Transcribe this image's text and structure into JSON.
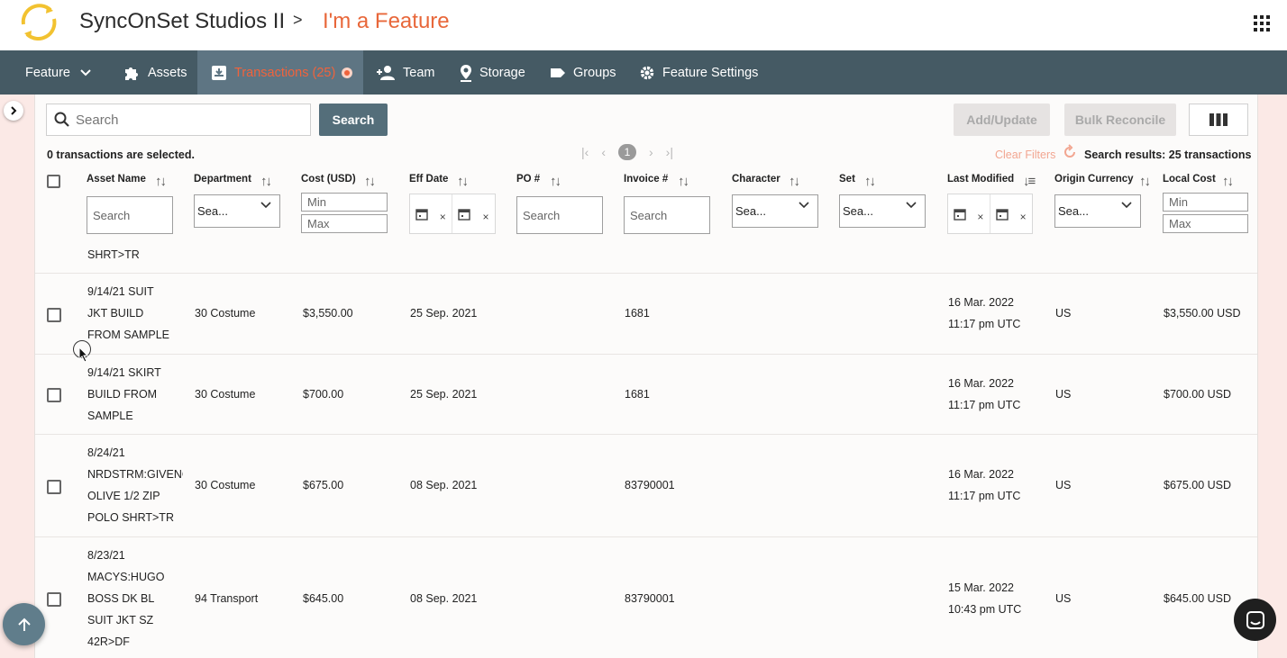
{
  "app": {
    "studio_name": "SyncOnSet Studios II",
    "breadcrumb_sep": ">",
    "feature_name": "I'm a Feature"
  },
  "nav": {
    "feature_label": "Feature",
    "assets_label": "Assets",
    "transactions_label": "Transactions (25)",
    "team_label": "Team",
    "storage_label": "Storage",
    "groups_label": "Groups",
    "settings_label": "Feature Settings"
  },
  "toolbar": {
    "search_placeholder": "Search",
    "search_button": "Search",
    "add_update": "Add/Update",
    "bulk_reconcile": "Bulk Reconcile"
  },
  "status": {
    "selected_text": "0 transactions are selected.",
    "page_number": "1",
    "clear_filters": "Clear Filters",
    "results_prefix": "Search results: ",
    "results_count": "25 transactions"
  },
  "columns": {
    "asset_name": "Asset Name",
    "department": "Department",
    "cost": "Cost (USD)",
    "eff_date": "Eff Date",
    "po": "PO #",
    "invoice": "Invoice #",
    "character": "Character",
    "set": "Set",
    "last_modified": "Last Modified",
    "origin_currency": "Origin Currency",
    "local_cost": "Local Cost"
  },
  "filters": {
    "search": "Search",
    "select_sea": "Sea...",
    "min": "Min",
    "max": "Max",
    "date_clear": "×"
  },
  "partial_row_text": "SHRT>TR",
  "rows": [
    {
      "asset": [
        "9/14/21 SUIT",
        "JKT BUILD",
        "FROM SAMPLE"
      ],
      "department": "30 Costume",
      "cost": "$3,550.00",
      "eff_date": "25 Sep. 2021",
      "invoice": "1681",
      "modified_date": "16 Mar. 2022",
      "modified_time": "11:17 pm UTC",
      "currency": "US",
      "local_cost": "$3,550.00 USD"
    },
    {
      "asset": [
        "9/14/21 SKIRT",
        "BUILD FROM",
        "SAMPLE"
      ],
      "department": "30 Costume",
      "cost": "$700.00",
      "eff_date": "25 Sep. 2021",
      "invoice": "1681",
      "modified_date": "16 Mar. 2022",
      "modified_time": "11:17 pm UTC",
      "currency": "US",
      "local_cost": "$700.00 USD"
    },
    {
      "asset": [
        "8/24/21",
        "NRDSTRM:GIVENCHY",
        "OLIVE 1/2 ZIP",
        "POLO SHRT>TR"
      ],
      "department": "30 Costume",
      "cost": "$675.00",
      "eff_date": "08 Sep. 2021",
      "invoice": "83790001",
      "modified_date": "16 Mar. 2022",
      "modified_time": "11:17 pm UTC",
      "currency": "US",
      "local_cost": "$675.00 USD"
    },
    {
      "asset": [
        "8/23/21",
        "MACYS:HUGO",
        "BOSS DK BL",
        "SUIT JKT SZ",
        "42R>DF"
      ],
      "department": "94 Transport",
      "cost": "$645.00",
      "eff_date": "08 Sep. 2021",
      "invoice": "83790001",
      "modified_date": "15 Mar. 2022",
      "modified_time": "10:43 pm UTC",
      "currency": "US",
      "local_cost": "$645.00 USD"
    }
  ],
  "colors": {
    "nav_bg": "#455a64",
    "nav_active_bg": "#5e7583",
    "accent": "#e8673a",
    "primary_button": "#546e7a"
  }
}
